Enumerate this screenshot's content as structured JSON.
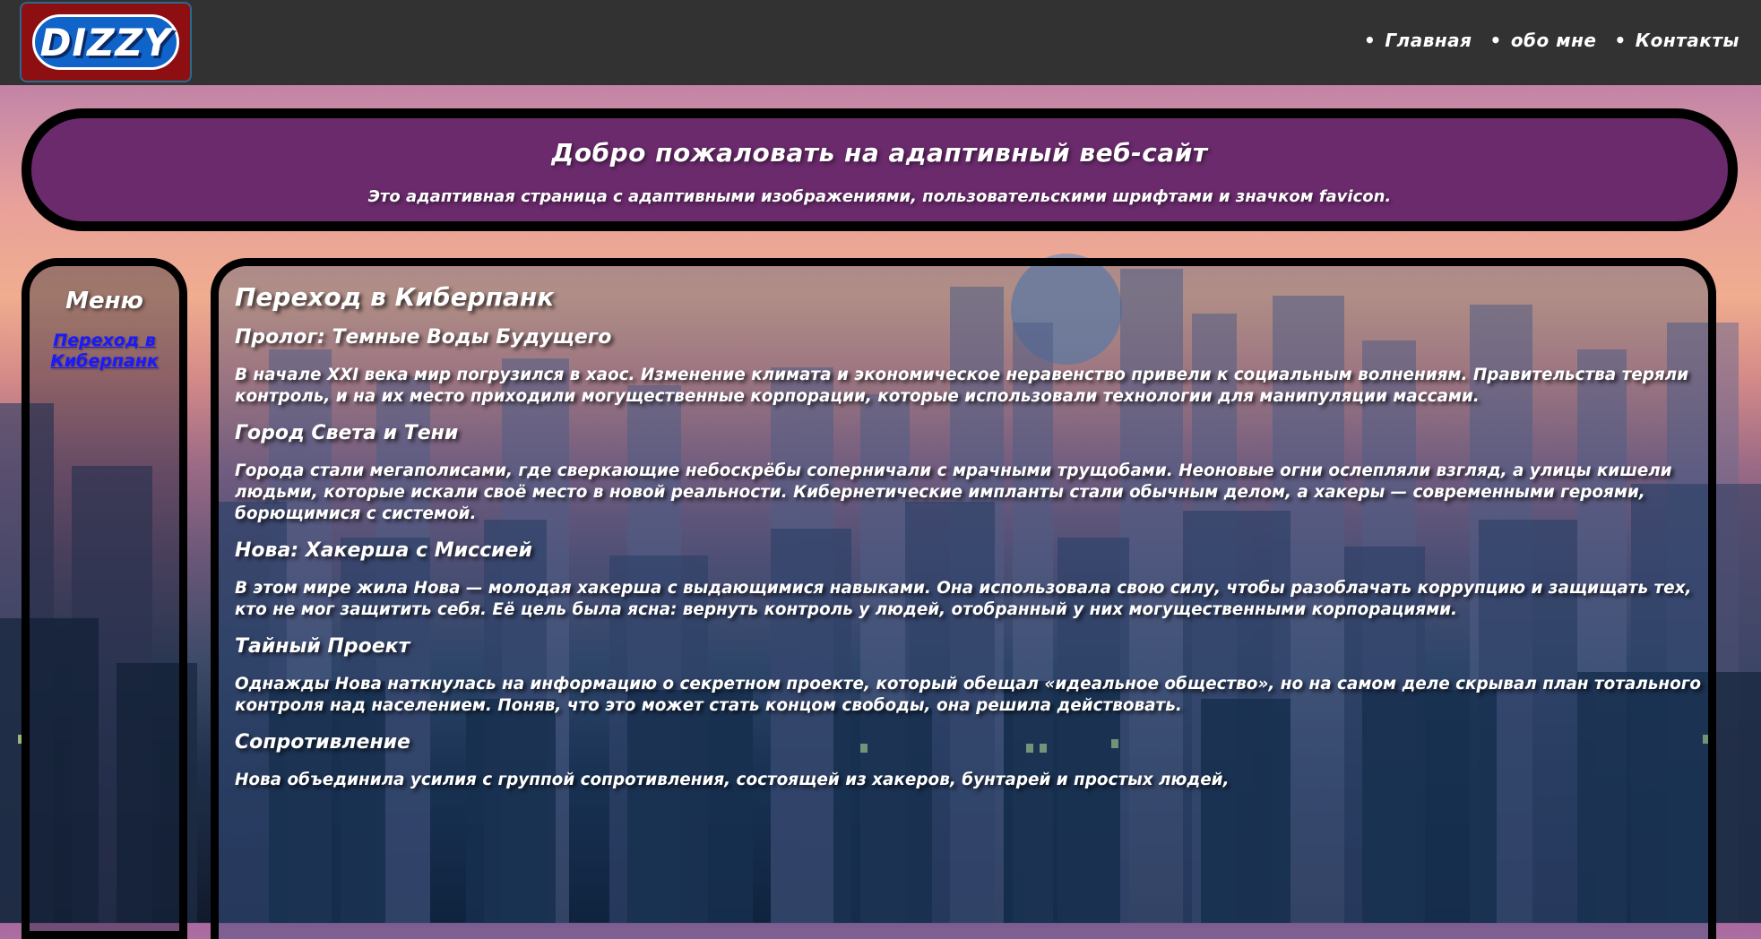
{
  "header": {
    "logo_text": "DIZZY",
    "nav": [
      "Главная",
      "обо мне",
      "Контакты"
    ]
  },
  "hero": {
    "title": "Добро пожаловать на адаптивный веб-сайт",
    "subtitle": "Это адаптивная страница с адаптивными изображениями, пользовательскими шрифтами и значком favicon."
  },
  "sidebar": {
    "title": "Меню",
    "link": "Переход в Киберпанк"
  },
  "article": {
    "title": "Переход в Киберпанк",
    "sections": [
      {
        "heading": "Пролог: Темные Воды Будущего",
        "text": "В начале XXI века мир погрузился в хаос. Изменение климата и экономическое неравенство привели к социальным волнениям. Правительства теряли контроль, и на их место приходили могущественные корпорации, которые использовали технологии для манипуляции массами."
      },
      {
        "heading": "Город Света и Тени",
        "text": "Города стали мегаполисами, где сверкающие небоскрёбы соперничали с мрачными трущобами. Неоновые огни ослепляли взгляд, а улицы кишели людьми, которые искали своё место в новой реальности. Кибернетические импланты стали обычным делом, а хакеры — современными героями, борющимися с системой."
      },
      {
        "heading": "Нова: Хакерша с Миссией",
        "text": "В этом мире жила Нова — молодая хакерша с выдающимися навыками. Она использовала свою силу, чтобы разоблачать коррупцию и защищать тех, кто не мог защитить себя. Её цель была ясна: вернуть контроль у людей, отобранный у них могущественными корпорациями."
      },
      {
        "heading": "Тайный Проект",
        "text": "Однажды Нова наткнулась на информацию о секретном проекте, который обещал «идеальное общество», но на самом деле скрывал план тотального контроля над населением. Поняв, что это может стать концом свободы, она решила действовать."
      },
      {
        "heading": "Сопротивление",
        "text": "Нова объединила усилия с группой сопротивления, состоящей из хакеров, бунтарей и простых людей,"
      }
    ]
  },
  "colors": {
    "topbar": "#323232",
    "hero_bg": "#6a2a6c",
    "logo_bg": "#8e0f12",
    "logo_pill": "#0f63c9",
    "link": "#1a1aff"
  }
}
